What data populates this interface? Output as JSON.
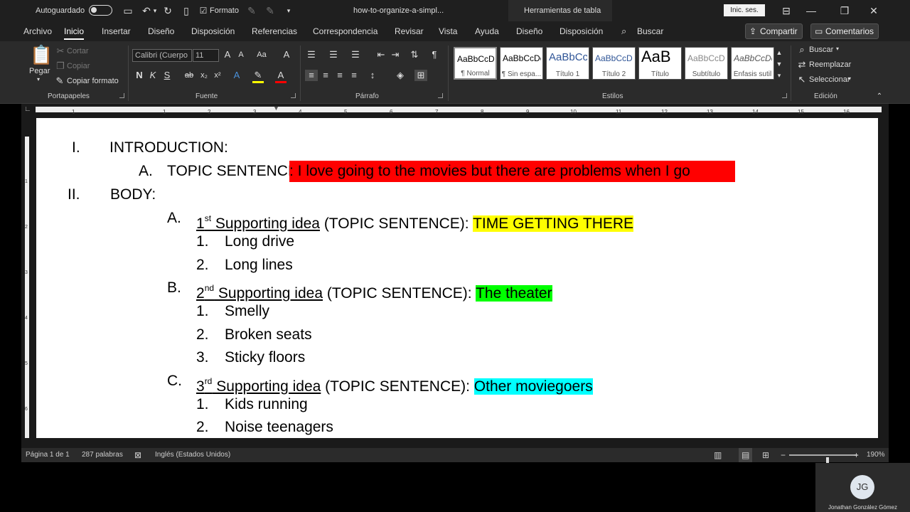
{
  "titlebar": {
    "autosave_label": "Autoguardado",
    "format_label": "Formato",
    "doc_title": "how-to-organize-a-simpl...",
    "context_tab": "Herramientas de tabla",
    "signin": "Inic. ses."
  },
  "menu": {
    "tabs": [
      "Archivo",
      "Inicio",
      "Insertar",
      "Diseño",
      "Disposición",
      "Referencias",
      "Correspondencia",
      "Revisar",
      "Vista",
      "Ayuda",
      "Diseño",
      "Disposición"
    ],
    "search": "Buscar",
    "share": "Compartir",
    "comments": "Comentarios"
  },
  "ribbon": {
    "clipboard": {
      "paste": "Pegar",
      "cut": "Cortar",
      "copy": "Copiar",
      "format_painter": "Copiar formato",
      "label": "Portapapeles"
    },
    "font": {
      "family": "Calibri (Cuerpo",
      "size": "11",
      "label": "Fuente"
    },
    "paragraph": {
      "label": "Párrafo"
    },
    "styles": {
      "label": "Estilos",
      "items": [
        {
          "sample": "AaBbCcDc",
          "name": "¶ Normal"
        },
        {
          "sample": "AaBbCcDc",
          "name": "¶ Sin espa..."
        },
        {
          "sample": "AaBbCc",
          "name": "Título 1"
        },
        {
          "sample": "AaBbCcD",
          "name": "Título 2"
        },
        {
          "sample": "AaB",
          "name": "Título"
        },
        {
          "sample": "AaBbCcD",
          "name": "Subtítulo"
        },
        {
          "sample": "AaBbCcDc",
          "name": "Énfasis sutil"
        }
      ]
    },
    "editing": {
      "find": "Buscar",
      "replace": "Reemplazar",
      "select": "Seleccionar",
      "label": "Edición"
    }
  },
  "ruler": {
    "numbers": [
      "1",
      "1",
      "2",
      "3",
      "4",
      "5",
      "6",
      "7",
      "8",
      "9",
      "10",
      "11",
      "12",
      "13",
      "14",
      "15",
      "16"
    ],
    "vnumbers": [
      "1",
      "2",
      "3",
      "4",
      "5",
      "6"
    ]
  },
  "document": {
    "intro_num": "I.",
    "intro": "INTRODUCTION:",
    "topic_letter": "A.",
    "topic_label": "TOPIC SENTENCE",
    "topic_text": ":   I love going to the movies but there are problems when I go",
    "body_num": "II.",
    "body": "BODY:",
    "points": [
      {
        "letter": "A.",
        "ordinal": "1",
        "suffix": "st",
        "idea": "  Supporting idea",
        "topic": " (TOPIC SENTENCE):  ",
        "highlight": "TIME GETTING THERE",
        "subs": [
          {
            "num": "1.",
            "text": "Long drive"
          },
          {
            "num": "2.",
            "text": "Long lines"
          }
        ]
      },
      {
        "letter": "B.",
        "ordinal": "2",
        "suffix": "nd",
        "idea": "  Supporting idea",
        "topic": " (TOPIC SENTENCE): ",
        "highlight": "The theater",
        "subs": [
          {
            "num": "1.",
            "text": "Smelly"
          },
          {
            "num": "2.",
            "text": "Broken seats"
          },
          {
            "num": "3.",
            "text": "Sticky floors"
          }
        ]
      },
      {
        "letter": "C.",
        "ordinal": "3",
        "suffix": "rd",
        "idea": "  Supporting idea",
        "topic": " (TOPIC SENTENCE): ",
        "highlight": "Other moviegoers",
        "subs": [
          {
            "num": "1.",
            "text": "Kids running"
          },
          {
            "num": "2.",
            "text": "Noise teenagers"
          }
        ]
      }
    ]
  },
  "status": {
    "page": "Página 1 de 1",
    "words": "287 palabras",
    "language": "Inglés (Estados Unidos)",
    "zoom": "190%",
    "zoom_fraction": 0.56
  },
  "webcam": {
    "initials": "JG",
    "name": "Jonathan González Gómez"
  }
}
